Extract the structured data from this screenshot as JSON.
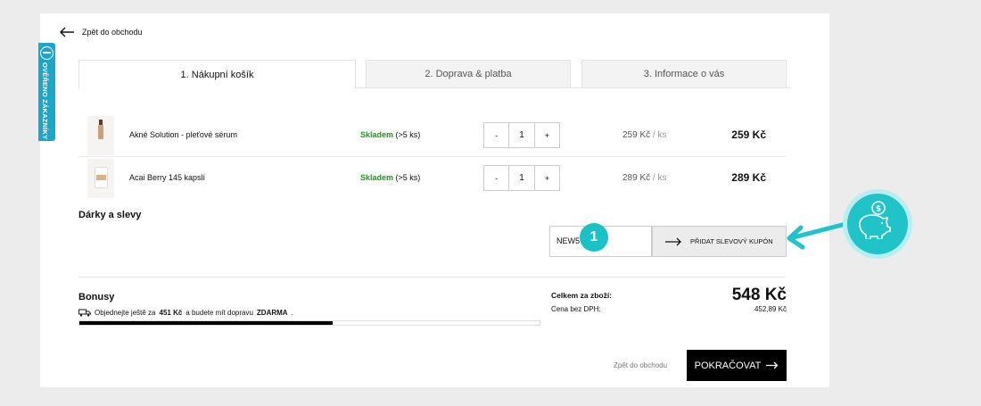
{
  "nav": {
    "back_to_shop": "Zpět do obchodu"
  },
  "verified_badge": {
    "label": "OVĚŘENO ZÁKAZNÍKY"
  },
  "steps": [
    {
      "label": "1. Nákupní košík"
    },
    {
      "label": "2. Doprava & platba"
    },
    {
      "label": "3. Informace o vás"
    }
  ],
  "cart": {
    "items": [
      {
        "name": "Akné Solution - pleťové sérum",
        "stock_status": "Skladem",
        "stock_count": "(>5 ks)",
        "qty_minus": "-",
        "qty": "1",
        "qty_plus": "+",
        "unit_price": "259 Kč",
        "unit_suffix": "/ ks",
        "total": "259 Kč"
      },
      {
        "name": "Acai Berry 145 kapslí",
        "stock_status": "Skladem",
        "stock_count": "(>5 ks)",
        "qty_minus": "-",
        "qty": "1",
        "qty_plus": "+",
        "unit_price": "289 Kč",
        "unit_suffix": "/ ks",
        "total": "289 Kč"
      }
    ]
  },
  "gifts": {
    "title": "Dárky a slevy",
    "coupon_value": "NEW5",
    "coupon_button": "PŘIDAT SLEVOVÝ KUPÓN",
    "step_badge": "1"
  },
  "bonus": {
    "title": "Bonusy",
    "ship_prefix": "Objednejte ještě za",
    "ship_amount": "451 Kč",
    "ship_middle": "a budete mít dopravu",
    "ship_free": "ZDARMA",
    "ship_end": ".",
    "progress_percent": 55
  },
  "summary": {
    "total_label": "Celkem za zboží:",
    "total_value": "548 Kč",
    "net_label": "Cena bez DPH:",
    "net_value": "452,89 Kč"
  },
  "footer": {
    "back_label": "Zpět do obchodu",
    "continue_label": "POKRAČOVAT"
  },
  "colors": {
    "accent": "#1fc3c8",
    "in_stock": "#1c9a1c",
    "primary_button": "#000000",
    "verified_tab": "#1aa7c9"
  }
}
